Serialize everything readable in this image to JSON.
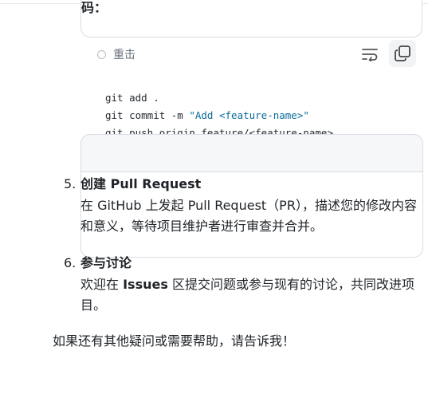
{
  "top_box": {
    "partial_text": "码："
  },
  "reset": {
    "label": "重击"
  },
  "code_block": {
    "lines": [
      {
        "plain": "git add .",
        "string": ""
      },
      {
        "plain": "git commit -m ",
        "string": "\"Add <feature-name>\""
      },
      {
        "plain": "git push origin feature/<feature-name>",
        "string": ""
      }
    ]
  },
  "steps": [
    {
      "number": "5.",
      "title_bold": "创建",
      "title_rest": " Pull Request",
      "body": "在 GitHub 上发起 Pull Request（PR），描述您的修改内容和意义，等待项目维护者进行审查并合并。"
    },
    {
      "number": "6.",
      "title_bold": "参与讨论",
      "title_rest": "",
      "body_prefix": "欢迎在 ",
      "body_bold": "Issues",
      "body_suffix": " 区提交问题或参与现有的讨论，共同改进项目。"
    }
  ],
  "closing": "如果还有其他疑问或需要帮助，请告诉我！",
  "colors": {
    "text": "#1f2328",
    "muted": "#6a737d",
    "border": "#d8dde3",
    "code_string": "#0b6a9a"
  }
}
